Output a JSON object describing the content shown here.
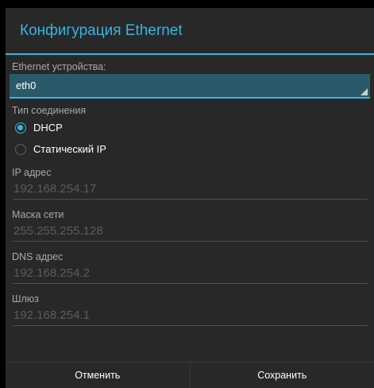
{
  "dialog": {
    "title": "Конфигурация Ethernet",
    "devices_label": "Ethernet устройства:",
    "device_selected": "eth0",
    "connection_type_label": "Тип соединения",
    "options": [
      {
        "label": "DHCP",
        "checked": true
      },
      {
        "label": "Статический IP",
        "checked": false
      }
    ],
    "fields": [
      {
        "label": "IP адрес",
        "value": "192.168.254.17"
      },
      {
        "label": "Маска сети",
        "value": "255.255.255.128"
      },
      {
        "label": "DNS адрес",
        "value": "192.168.254.2"
      },
      {
        "label": "Шлюз",
        "value": "192.168.254.1"
      }
    ],
    "buttons": {
      "cancel": "Отменить",
      "save": "Сохранить"
    }
  },
  "colors": {
    "accent": "#33b5e5",
    "background": "#282828"
  }
}
